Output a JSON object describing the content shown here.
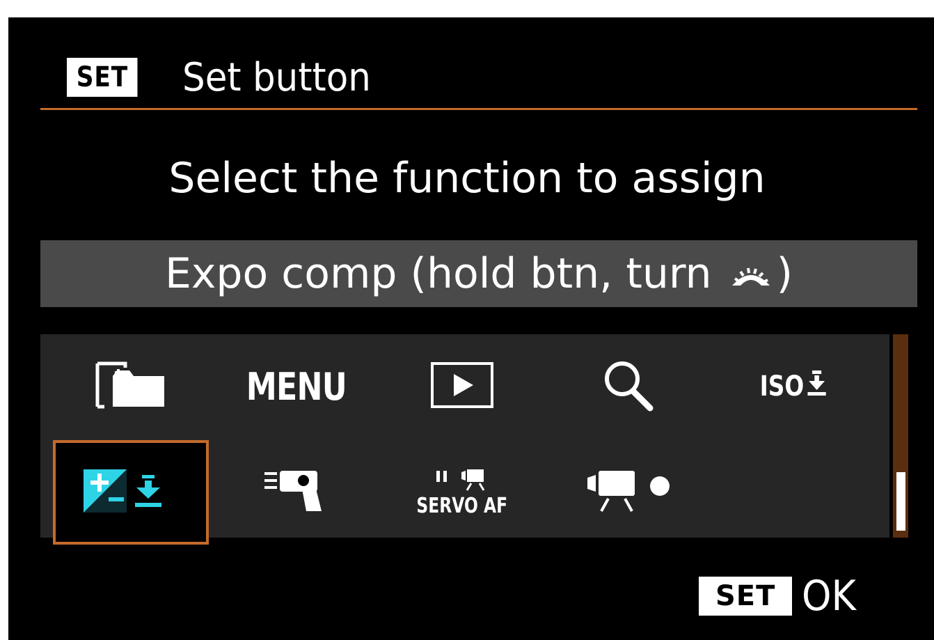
{
  "header": {
    "key_label": "SET",
    "title": "Set button"
  },
  "prompt": "Select the function to assign",
  "selected_function": {
    "label_prefix": "Expo comp (hold btn, turn",
    "label_icon": "main-dial-icon",
    "label_suffix": ")"
  },
  "functions": {
    "row1": [
      {
        "icon": "image-folder-icon"
      },
      {
        "label": "MENU"
      },
      {
        "icon": "playback-icon"
      },
      {
        "icon": "magnify-icon"
      },
      {
        "label": "ISO",
        "icon": "set-down-arrow-icon"
      }
    ],
    "row2": [
      {
        "icon": "exposure-compensation-set-icon",
        "selected": true
      },
      {
        "icon": "flash-function-icon"
      },
      {
        "label": "SERVO AF",
        "icon": "movie-servo-af-pause-icon"
      },
      {
        "icon": "movie-record-icon"
      }
    ]
  },
  "scroll": {
    "position": 1.0
  },
  "footer": {
    "key_label": "SET",
    "ok_label": "OK"
  },
  "colors": {
    "accent": "#c56a2a",
    "icon_selected": "#2ed3e6",
    "selected_bar": "#4a4a4a",
    "panel": "#262626"
  }
}
